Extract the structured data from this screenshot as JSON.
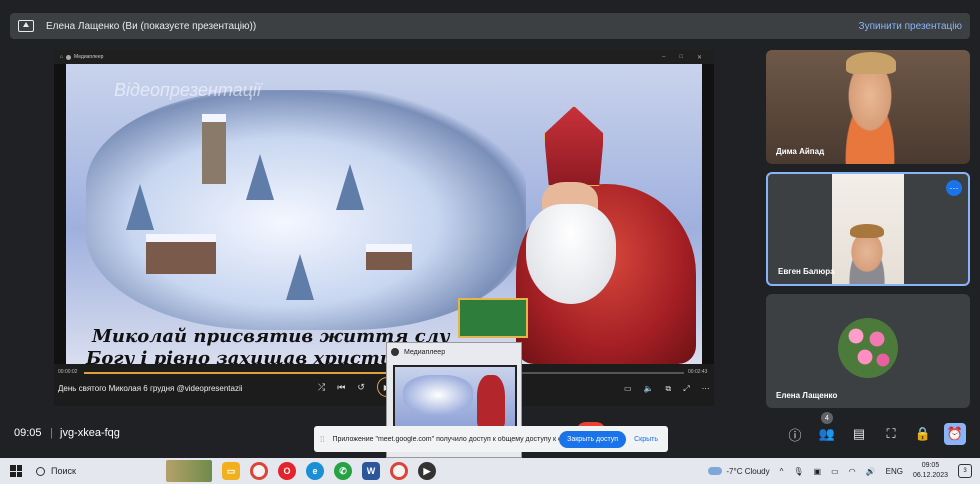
{
  "topbar": {
    "title": "Елена Лащенко (Ви (показуєте презентацію))",
    "stop_label": "Зупинити презентацію"
  },
  "shared_window": {
    "app_title": "Медиаплеер",
    "watermark": "Відеопрезентації",
    "caption_line1": "Миколай присвятив життя слу",
    "caption_line2": "Богу і рівно захищав християно",
    "time_elapsed": "00:00:02",
    "time_total": "00:02:43",
    "progress": 0.53,
    "video_title": "День святого Миколая 6 грудня @videopresentazii"
  },
  "mini_player": {
    "title": "Медиаплеер"
  },
  "participants": [
    {
      "name": "Дима Айпад"
    },
    {
      "name": "Евген Балюра"
    },
    {
      "name": "Елена Лащенко"
    }
  ],
  "meeting": {
    "time": "09:05",
    "code": "jvg-xkea-fqg",
    "participant_count": "4"
  },
  "notification": {
    "text": "Приложение \"meet.google.com\" получило доступ к общему доступу к окну.",
    "grant_label": "Закрыть доступ",
    "hide_label": "Скрыть"
  },
  "taskbar": {
    "search_label": "Поиск",
    "weather": "-7°C  Cloudy",
    "lang": "ENG",
    "time": "09:05",
    "date": "06.12.2023",
    "notify_count": "3"
  },
  "colors": {
    "accent": "#8ab4f8",
    "meet_bg": "#202124",
    "danger": "#ea4335",
    "primary": "#1a73e8"
  }
}
